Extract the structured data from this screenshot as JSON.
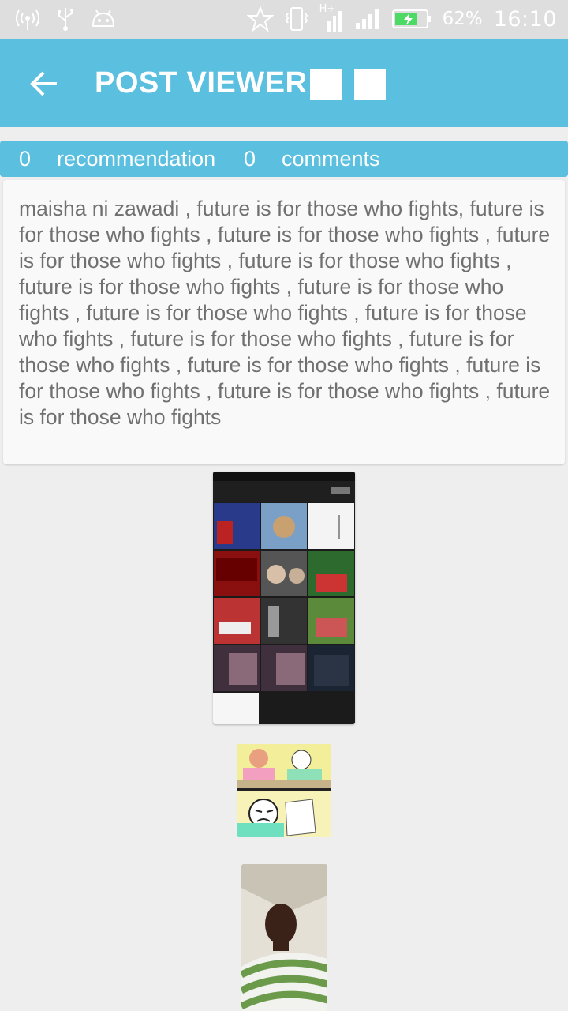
{
  "status_bar": {
    "battery_percent": "62%",
    "time": "16:10",
    "network_label": "H+",
    "icons": [
      "wifi-hotspot-icon",
      "usb-icon",
      "android-debug-icon",
      "star-icon",
      "vibrate-icon",
      "h-plus-signal-icon",
      "signal-icon",
      "battery-charging-icon"
    ]
  },
  "app_bar": {
    "title": "POST VIEWER"
  },
  "stats": {
    "recommendation_count": "0",
    "recommendation_label": "recommendation",
    "comments_count": "0",
    "comments_label": "comments"
  },
  "post": {
    "text": "maisha ni zawadi , future is for those who fights, future is for those who fights , future is for those who fights , future is for those who fights , future is for those who fights , future is for those who fights , future is for those who fights , future is for those who fights , future is for those who fights , future is for those who fights , future is for those who fights , future is for those who fights , future is for those who fights , future is for those who fights , future is for those who fights"
  },
  "colors": {
    "accent": "#5bbfe0",
    "background": "#eeeeee",
    "card": "#f9f9f9",
    "post_text": "#707070"
  }
}
